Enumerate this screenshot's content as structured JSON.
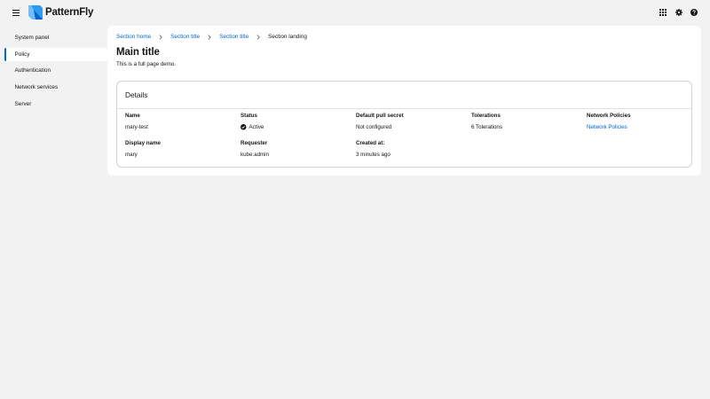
{
  "masthead": {
    "brand": "PatternFly",
    "brand_color": "#2b9af3",
    "tools": [
      "apps-grid-icon",
      "gear-icon",
      "help-icon"
    ]
  },
  "sidebar": {
    "items": [
      {
        "label": "System panel",
        "active": false
      },
      {
        "label": "Policy",
        "active": true
      },
      {
        "label": "Authentication",
        "active": false
      },
      {
        "label": "Network services",
        "active": false
      },
      {
        "label": "Server",
        "active": false
      }
    ]
  },
  "breadcrumb": {
    "items": [
      "Section home",
      "Section title",
      "Section title"
    ],
    "current": "Section landing"
  },
  "page": {
    "title": "Main title",
    "description": "This is a full page demo."
  },
  "details": {
    "title": "Details",
    "fields": [
      {
        "label": "Name",
        "value": "mary-test"
      },
      {
        "label": "Status",
        "value": "Active",
        "icon": "check-circle-icon"
      },
      {
        "label": "Default pull secret",
        "value": "Not configured"
      },
      {
        "label": "Tolerations",
        "value": "6 Tolerations"
      },
      {
        "label": "Network Policies",
        "value": "Network Policies",
        "link": true
      },
      {
        "label": "Display name",
        "value": "mary"
      },
      {
        "label": "Requester",
        "value": "kube:admin"
      },
      {
        "label": "Created at:",
        "value": "3 minutes ago"
      }
    ]
  },
  "colors": {
    "accent": "#0066cc",
    "background": "#f2f2f2",
    "surface": "#ffffff"
  }
}
